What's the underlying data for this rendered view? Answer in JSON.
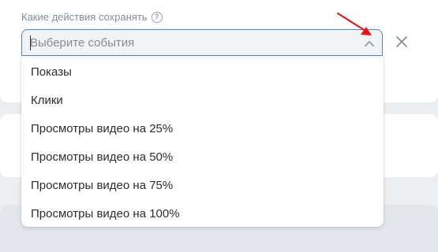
{
  "field": {
    "label": "Какие действия сохранять",
    "help_icon": "question-circle-icon",
    "placeholder": "Выберите события",
    "value": ""
  },
  "options": [
    "Показы",
    "Клики",
    "Просмотры видео на 25%",
    "Просмотры видео на 50%",
    "Просмотры видео на 75%",
    "Просмотры видео на 100%"
  ],
  "icons": {
    "toggle": "chevron-up-icon",
    "remove": "close-icon",
    "annotation": "red-arrow-icon"
  },
  "background_link": "",
  "colors": {
    "accent": "#4986cc",
    "annotation": "#e8141b",
    "page_bg": "#edeef0",
    "card_bg": "#ffffff",
    "link": "#2d81e0"
  }
}
